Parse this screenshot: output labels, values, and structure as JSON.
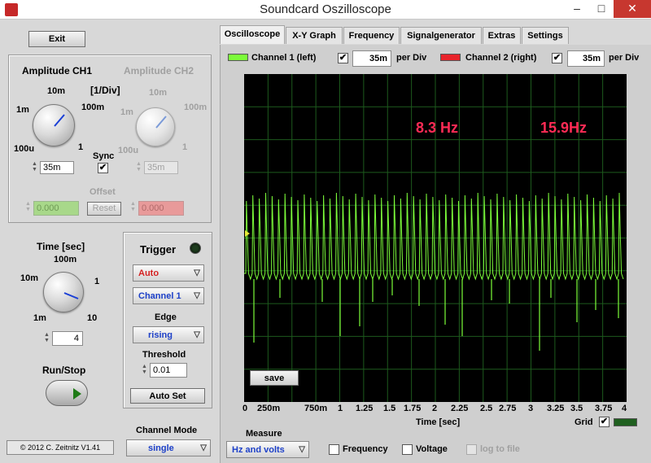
{
  "window": {
    "title": "Soundcard Oszilloscope",
    "controls": [
      "–",
      "□",
      "✕"
    ]
  },
  "left": {
    "exit_label": "Exit",
    "amp_ch1_title": "Amplitude CH1",
    "amp_ch2_title": "Amplitude CH2",
    "div_label": "[1/Div]",
    "ch1_knob_labels": [
      "10m",
      "1m",
      "100m",
      "100u",
      "1"
    ],
    "ch2_knob_labels": [
      "10m",
      "1m",
      "100m",
      "100u",
      "1"
    ],
    "ch1_value": "35m",
    "ch2_value": "35m",
    "sync_label": "Sync",
    "sync_checked": "✔",
    "offset_label": "Offset",
    "ch1_offset": "0.000",
    "ch2_offset": "0.000",
    "reset_label": "Reset",
    "time_title": "Time [sec]",
    "time_knob_labels": [
      "100m",
      "10m",
      "1",
      "1m",
      "10"
    ],
    "time_value": "4",
    "runstop_label": "Run/Stop",
    "copyright": "© 2012  C. Zeitnitz V1.41"
  },
  "trigger": {
    "title": "Trigger",
    "mode": "Auto",
    "channel": "Channel 1",
    "edge_label": "Edge",
    "edge": "rising",
    "threshold_label": "Threshold",
    "threshold": "0.01",
    "autoset_label": "Auto Set",
    "led_color": "#1e3d1e"
  },
  "channel_mode": {
    "label": "Channel Mode",
    "value": "single"
  },
  "tabs": [
    "Oscilloscope",
    "X-Y Graph",
    "Frequency",
    "Signalgenerator",
    "Extras",
    "Settings"
  ],
  "channels": {
    "ch1_label": "Channel 1 (left)",
    "ch1_color": "#7cfc3a",
    "ch1_per_div": "35m",
    "ch2_label": "Channel 2 (right)",
    "ch2_color": "#e8242b",
    "ch2_per_div": "35m",
    "per_div_label": "per Div",
    "checked": "✔"
  },
  "plot": {
    "freq_ch1": "8.3 Hz",
    "freq_ch2": "15.9Hz",
    "trace_color": "#7cfc3a",
    "save_label": "save",
    "x_ticks": [
      "0",
      "250m",
      "750m",
      "1",
      "1.25",
      "1.5",
      "1.75",
      "2",
      "2.25",
      "2.5",
      "2.75",
      "3",
      "3.25",
      "3.5",
      "3.75",
      "4"
    ],
    "x_label": "Time [sec]",
    "grid_label": "Grid",
    "grid_checked": "✔"
  },
  "measure": {
    "label": "Measure",
    "value": "Hz and volts",
    "frequency_label": "Frequency",
    "voltage_label": "Voltage",
    "log_label": "log to file"
  }
}
